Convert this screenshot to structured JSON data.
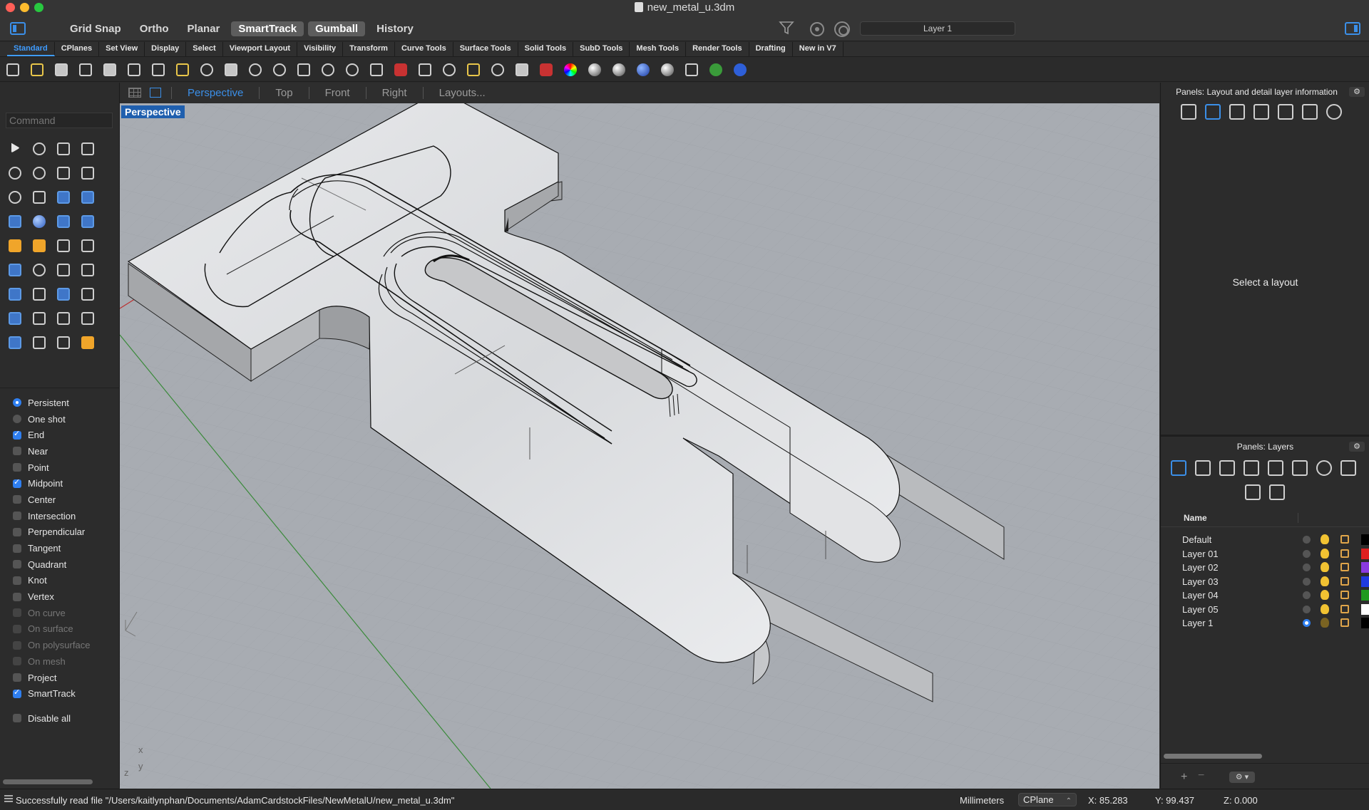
{
  "window": {
    "title": "new_metal_u.3dm",
    "modes": [
      {
        "label": "Grid Snap",
        "active": false
      },
      {
        "label": "Ortho",
        "active": false
      },
      {
        "label": "Planar",
        "active": false
      },
      {
        "label": "SmartTrack",
        "active": true
      },
      {
        "label": "Gumball",
        "active": true
      },
      {
        "label": "History",
        "active": false
      }
    ],
    "current_layer": "Layer 1"
  },
  "tabs": [
    "Standard",
    "CPlanes",
    "Set View",
    "Display",
    "Select",
    "Viewport Layout",
    "Visibility",
    "Transform",
    "Curve Tools",
    "Surface Tools",
    "Solid Tools",
    "SubD Tools",
    "Mesh Tools",
    "Render Tools",
    "Drafting",
    "New in V7"
  ],
  "active_tab": "Standard",
  "toolbar_icons": [
    "new-file-icon",
    "open-folder-icon",
    "save-icon",
    "print-icon",
    "import-icon",
    "cut-icon",
    "copy-icon",
    "paste-icon",
    "undo-icon",
    "pan-hand-icon",
    "rotate-view-icon",
    "zoom-icon",
    "zoom-extents-icon",
    "zoom-window-icon",
    "zoom-selected-icon",
    "viewport-layout-icon",
    "car-render-icon",
    "toolbar-icon",
    "snap-icon",
    "points-icon",
    "light-icon",
    "lock-icon",
    "named-views-icon",
    "color-wheel-icon",
    "wireframe-sphere-icon",
    "shaded-sphere-icon",
    "rendered-sphere-icon",
    "render-icon",
    "transform-icon",
    "grasshopper-icon",
    "help-icon"
  ],
  "command": {
    "placeholder": "Command"
  },
  "osnap": {
    "mode": [
      {
        "label": "Persistent",
        "selected": true
      },
      {
        "label": "One shot",
        "selected": false
      }
    ],
    "items": [
      {
        "label": "End",
        "checked": true,
        "enabled": true
      },
      {
        "label": "Near",
        "checked": false,
        "enabled": true
      },
      {
        "label": "Point",
        "checked": false,
        "enabled": true
      },
      {
        "label": "Midpoint",
        "checked": true,
        "enabled": true
      },
      {
        "label": "Center",
        "checked": false,
        "enabled": true
      },
      {
        "label": "Intersection",
        "checked": false,
        "enabled": true
      },
      {
        "label": "Perpendicular",
        "checked": false,
        "enabled": true
      },
      {
        "label": "Tangent",
        "checked": false,
        "enabled": true
      },
      {
        "label": "Quadrant",
        "checked": false,
        "enabled": true
      },
      {
        "label": "Knot",
        "checked": false,
        "enabled": true
      },
      {
        "label": "Vertex",
        "checked": false,
        "enabled": true
      },
      {
        "label": "On curve",
        "checked": false,
        "enabled": false
      },
      {
        "label": "On surface",
        "checked": false,
        "enabled": false
      },
      {
        "label": "On polysurface",
        "checked": false,
        "enabled": false
      },
      {
        "label": "On mesh",
        "checked": false,
        "enabled": false
      },
      {
        "label": "Project",
        "checked": false,
        "enabled": true
      },
      {
        "label": "SmartTrack",
        "checked": true,
        "enabled": true
      }
    ],
    "disable_all": "Disable all"
  },
  "viewport_tabs": [
    {
      "label": "Perspective",
      "active": true
    },
    {
      "label": "Top",
      "active": false
    },
    {
      "label": "Front",
      "active": false
    },
    {
      "label": "Right",
      "active": false
    },
    {
      "label": "Layouts...",
      "active": false
    }
  ],
  "viewport": {
    "label": "Perspective",
    "axes": {
      "x": "x",
      "y": "y",
      "z": "z"
    }
  },
  "panels": {
    "layout_title": "Panels: Layout and detail layer information",
    "layout_message": "Select a layout",
    "layers_title": "Panels: Layers",
    "name_header": "Name",
    "layers": [
      {
        "name": "Default",
        "color": "#000000",
        "current": false,
        "visible": true
      },
      {
        "name": "Layer 01",
        "color": "#e02020",
        "current": false,
        "visible": true
      },
      {
        "name": "Layer 02",
        "color": "#8a3be0",
        "current": false,
        "visible": true
      },
      {
        "name": "Layer 03",
        "color": "#1f3ae0",
        "current": false,
        "visible": true
      },
      {
        "name": "Layer 04",
        "color": "#1f9a1f",
        "current": false,
        "visible": true
      },
      {
        "name": "Layer 05",
        "color": "#ffffff",
        "current": false,
        "visible": true
      },
      {
        "name": "Layer 1",
        "color": "#000000",
        "current": true,
        "visible": false
      }
    ]
  },
  "status": {
    "message": "Successfully read file \"/Users/kaitlynphan/Documents/AdamCardstockFiles/NewMetalU/new_metal_u.3dm\"",
    "units": "Millimeters",
    "cplane": "CPlane",
    "x": "X: 85.283",
    "y": "Y: 99.437",
    "z": "Z: 0.000"
  }
}
